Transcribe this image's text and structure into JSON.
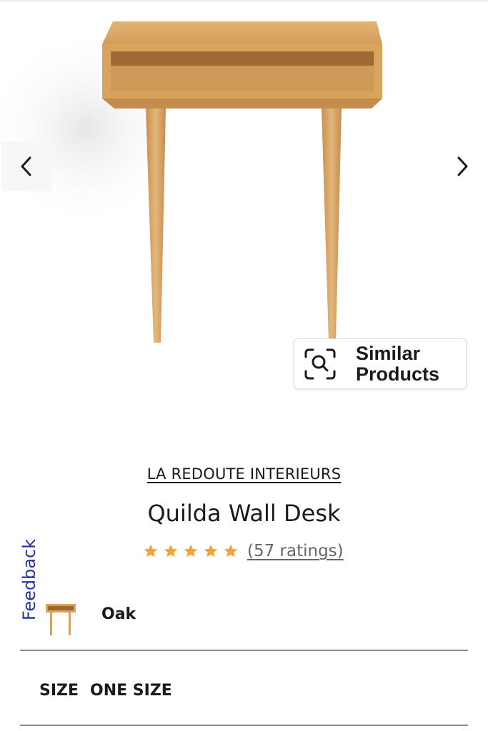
{
  "product": {
    "brand": "LA REDOUTE INTERIEURS",
    "title": "Quilda Wall Desk",
    "rating": {
      "stars": 5,
      "count_label": "(57 ratings)"
    },
    "color": {
      "name": "Oak"
    },
    "size": {
      "label": "SIZE",
      "value": "ONE SIZE"
    }
  },
  "gallery": {
    "prev_icon": "chevron-left-icon",
    "next_icon": "chevron-right-icon",
    "similar_products_label": "Similar Products",
    "similar_icon": "visual-search-icon"
  },
  "feedback": {
    "label": "Feedback"
  },
  "colors": {
    "star": "#f0a43a",
    "feedback": "#2b2fa3",
    "wood": "#d9a560",
    "divider": "#8c8c8c"
  }
}
